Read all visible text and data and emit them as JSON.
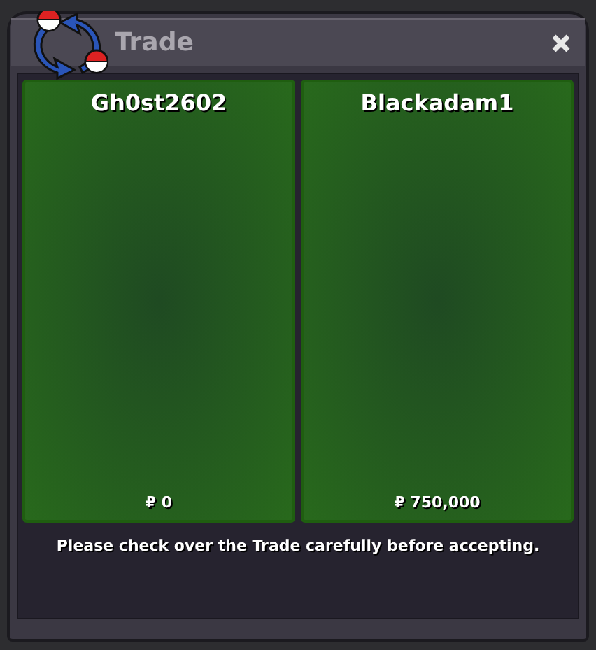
{
  "window": {
    "title": "Trade"
  },
  "offers": [
    {
      "player": "Gh0st2602",
      "money": "₽ 0"
    },
    {
      "player": "Blackadam1",
      "money": "₽ 750,000"
    }
  ],
  "notice": "Please check over the Trade carefully before accepting."
}
